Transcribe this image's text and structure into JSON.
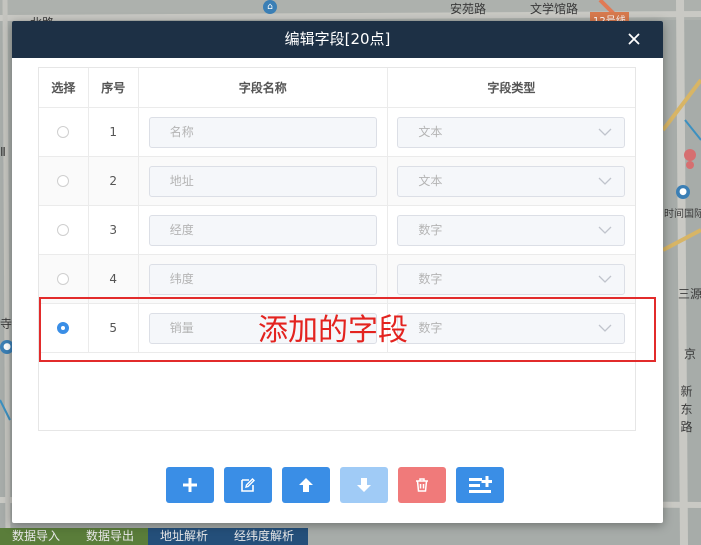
{
  "map": {
    "labels": [
      "北路",
      "安苑路",
      "文学馆路",
      "12号线",
      "Ⅱ",
      "寺",
      "京",
      "三源",
      "时间国际",
      "新\n东\n路"
    ],
    "bottom_buttons": [
      "数据导入",
      "数据导出",
      "地址解析",
      "经纬度解析"
    ]
  },
  "dialog": {
    "title": "编辑字段[20点]",
    "close_label": "×",
    "columns": [
      "选择",
      "序号",
      "字段名称",
      "字段类型"
    ],
    "rows": [
      {
        "index": "1",
        "name_placeholder": "名称",
        "type": "文本",
        "selected": false
      },
      {
        "index": "2",
        "name_placeholder": "地址",
        "type": "文本",
        "selected": false
      },
      {
        "index": "3",
        "name_placeholder": "经度",
        "type": "数字",
        "selected": false
      },
      {
        "index": "4",
        "name_placeholder": "纬度",
        "type": "数字",
        "selected": false
      },
      {
        "index": "5",
        "name_placeholder": "销量",
        "type": "数字",
        "selected": true
      }
    ],
    "toolbar": [
      {
        "icon": "plus-icon",
        "state": "enabled"
      },
      {
        "icon": "edit-icon",
        "state": "enabled"
      },
      {
        "icon": "arrow-up-icon",
        "state": "enabled"
      },
      {
        "icon": "arrow-down-icon",
        "state": "disabled"
      },
      {
        "icon": "trash-icon",
        "state": "danger"
      },
      {
        "icon": "add-list-icon",
        "state": "enabled"
      }
    ]
  },
  "annotation": {
    "text": "添加的字段",
    "color": "#e3231f"
  },
  "colors": {
    "header_bg": "#1d3045",
    "primary": "#3a8ee6",
    "primary_disabled": "#a0cbf6",
    "danger": "#f07a7a"
  }
}
